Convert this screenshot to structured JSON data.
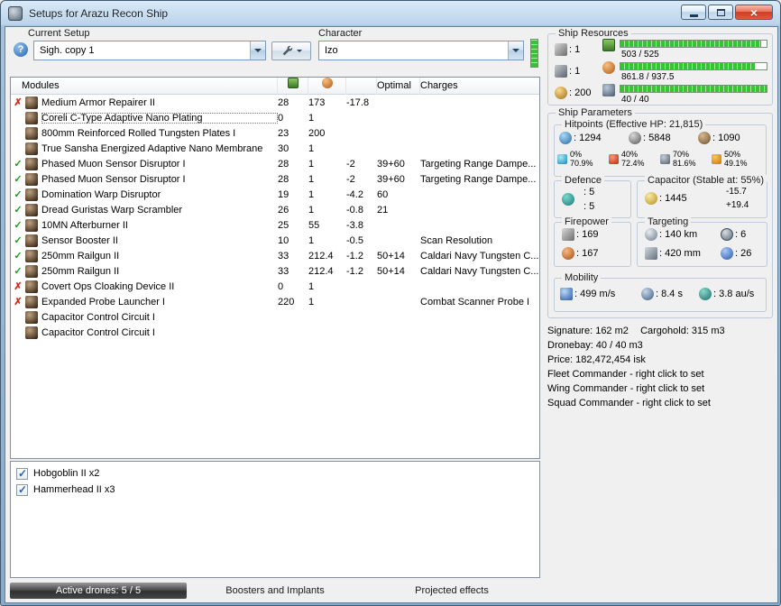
{
  "window": {
    "title": "Setups for Arazu Recon Ship"
  },
  "toolbar": {
    "current_setup_label": "Current Setup",
    "current_setup_value": "Sigh. copy 1",
    "character_label": "Character",
    "character_value": "Izo"
  },
  "modules": {
    "headers": {
      "name": "Modules",
      "optimal": "Optimal",
      "charges": "Charges"
    },
    "rows": [
      {
        "status": "error",
        "name": "Medium Armor Repairer II",
        "cpu": "28",
        "pg": "173",
        "cap": "-17.8",
        "optimal": "",
        "charges": ""
      },
      {
        "status": "none",
        "sel": "selected",
        "name": "Coreli C-Type Adaptive Nano Plating",
        "cpu": "0",
        "pg": "1",
        "cap": "",
        "optimal": "",
        "charges": ""
      },
      {
        "status": "none",
        "name": "800mm Reinforced Rolled Tungsten Plates I",
        "cpu": "23",
        "pg": "200",
        "cap": "",
        "optimal": "",
        "charges": ""
      },
      {
        "status": "none",
        "name": "True Sansha Energized Adaptive Nano Membrane",
        "cpu": "30",
        "pg": "1",
        "cap": "",
        "optimal": "",
        "charges": ""
      },
      {
        "status": "ok",
        "name": "Phased Muon Sensor Disruptor I",
        "cpu": "28",
        "pg": "1",
        "cap": "-2",
        "optimal": "39+60",
        "charges": "Targeting Range Dampe..."
      },
      {
        "status": "ok",
        "name": "Phased Muon Sensor Disruptor I",
        "cpu": "28",
        "pg": "1",
        "cap": "-2",
        "optimal": "39+60",
        "charges": "Targeting Range Dampe..."
      },
      {
        "status": "ok",
        "name": "Domination Warp Disruptor",
        "cpu": "19",
        "pg": "1",
        "cap": "-4.2",
        "optimal": "60",
        "charges": ""
      },
      {
        "status": "ok",
        "name": "Dread Guristas Warp Scrambler",
        "cpu": "26",
        "pg": "1",
        "cap": "-0.8",
        "optimal": "21",
        "charges": ""
      },
      {
        "status": "ok",
        "name": "10MN Afterburner II",
        "cpu": "25",
        "pg": "55",
        "cap": "-3.8",
        "optimal": "",
        "charges": ""
      },
      {
        "status": "ok",
        "name": "Sensor Booster II",
        "cpu": "10",
        "pg": "1",
        "cap": "-0.5",
        "optimal": "",
        "charges": "Scan Resolution"
      },
      {
        "status": "ok",
        "name": "250mm Railgun II",
        "cpu": "33",
        "pg": "212.4",
        "cap": "-1.2",
        "optimal": "50+14",
        "charges": "Caldari Navy Tungsten C..."
      },
      {
        "status": "ok",
        "name": "250mm Railgun II",
        "cpu": "33",
        "pg": "212.4",
        "cap": "-1.2",
        "optimal": "50+14",
        "charges": "Caldari Navy Tungsten C..."
      },
      {
        "status": "error",
        "name": "Covert Ops Cloaking Device II",
        "cpu": "0",
        "pg": "1",
        "cap": "",
        "optimal": "",
        "charges": ""
      },
      {
        "status": "error",
        "name": "Expanded Probe Launcher I",
        "cpu": "220",
        "pg": "1",
        "cap": "",
        "optimal": "",
        "charges": "Combat Scanner Probe I"
      },
      {
        "status": "none",
        "name": "Capacitor Control Circuit I",
        "cpu": "",
        "pg": "",
        "cap": "",
        "optimal": "",
        "charges": ""
      },
      {
        "status": "none",
        "name": "Capacitor Control Circuit I",
        "cpu": "",
        "pg": "",
        "cap": "",
        "optimal": "",
        "charges": ""
      }
    ]
  },
  "drones": {
    "items": [
      {
        "label": "Hobgoblin II x2",
        "state": "checked"
      },
      {
        "label": "Hammerhead II x3",
        "state": "checked"
      }
    ]
  },
  "bottom_tabs": [
    {
      "label": "Active drones: 5 / 5",
      "cls": "selected"
    },
    {
      "label": "Boosters and Implants"
    },
    {
      "label": "Projected effects"
    }
  ],
  "ship_resources": {
    "title": "Ship Resources",
    "hardpoints": [
      {
        "cls": "turret",
        "value": "1"
      },
      {
        "cls": "launcher",
        "value": "1"
      },
      {
        "cls": "calibration",
        "value": "200"
      }
    ],
    "bars": [
      {
        "cls": "cpu",
        "text": "503 / 525",
        "pct": 96
      },
      {
        "cls": "powergrid",
        "text": "861.8 / 937.5",
        "pct": 92
      },
      {
        "cls": "drone",
        "text": "40 / 40",
        "pct": 100
      }
    ]
  },
  "ship_parameters": {
    "title": "Ship Parameters",
    "hitpoints": {
      "title": "Hitpoints (Effective HP: 21,815)",
      "pools": [
        {
          "cls": "shield",
          "value": "1294"
        },
        {
          "cls": "armor",
          "value": "5848"
        },
        {
          "cls": "hull",
          "value": "1090"
        }
      ],
      "resists": [
        {
          "cls": "em",
          "shield": "0%",
          "armor": "70.9%"
        },
        {
          "cls": "thermal",
          "shield": "40%",
          "armor": "72.4%"
        },
        {
          "cls": "kinetic",
          "shield": "70%",
          "armor": "81.6%"
        },
        {
          "cls": "explosive",
          "shield": "50%",
          "armor": "49.1%"
        }
      ]
    },
    "defence": {
      "title": "Defence",
      "top": "5",
      "bottom": "5"
    },
    "capacitor": {
      "title": "Capacitor (Stable at: 55%)",
      "amount": "1445",
      "drain": "-15.7",
      "recharge": "+19.4"
    },
    "firepower": {
      "title": "Firepower",
      "volley": "169",
      "dps": "167"
    },
    "targeting": {
      "title": "Targeting",
      "range": "140 km",
      "max_targets": "6",
      "scan_resolution": "420 mm",
      "sensor_strength": "26"
    },
    "mobility": {
      "title": "Mobility",
      "speed": "499 m/s",
      "align_time": "8.4 s",
      "warp_speed": "3.8 au/s"
    }
  },
  "summary": {
    "signature": "Signature: 162 m2",
    "cargohold": "Cargohold: 315 m3",
    "droneb": "Dronebay: 40 / 40 m3",
    "price": "Price: 182,472,454 isk",
    "fleet": "Fleet Commander - right click to set",
    "wing": "Wing Commander - right click to set",
    "squad": "Squad Commander - right click to set"
  }
}
